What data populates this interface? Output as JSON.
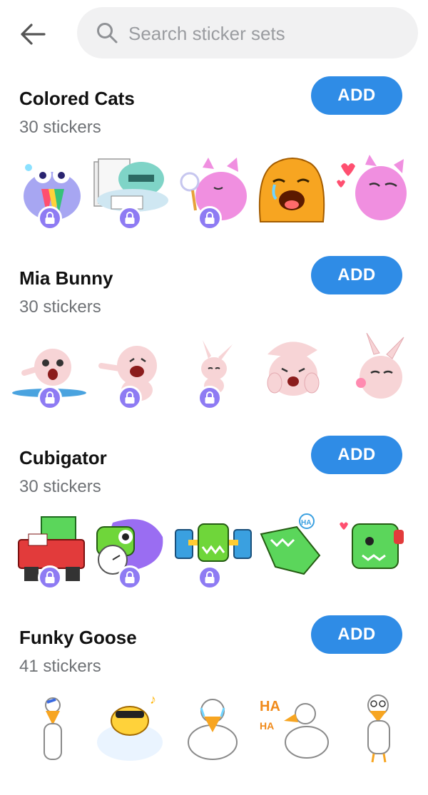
{
  "search": {
    "placeholder": "Search sticker sets"
  },
  "sets": [
    {
      "title": "Colored Cats",
      "count": "30 stickers",
      "add_label": "ADD",
      "stickers": [
        "purple-cat-rainbow",
        "teal-cat-papers",
        "pink-cat-bubbles",
        "orange-cat-crying",
        "pink-cat-hearts"
      ]
    },
    {
      "title": "Mia Bunny",
      "count": "30 stickers",
      "add_label": "ADD",
      "stickers": [
        "bunny-crying-pool",
        "bunny-laughing-pointing",
        "bunny-small-shy",
        "bunny-laughing-face",
        "bunny-blowing-kiss"
      ]
    },
    {
      "title": "Cubigator",
      "count": "30 stickers",
      "add_label": "ADD",
      "stickers": [
        "cubigator-red-car",
        "cubigator-stopwatch",
        "cubigator-dumbbells",
        "cubigator-laughing-ha",
        "cubigator-heart"
      ]
    },
    {
      "title": "Funky Goose",
      "count": "41 stickers",
      "add_label": "ADD",
      "stickers": [
        "goose-standing",
        "goose-sunglasses-music",
        "goose-crying",
        "goose-laughing-ha",
        "goose-glasses"
      ]
    }
  ],
  "stickers_text": {
    "ha": "HA",
    "ha_small": "HA"
  },
  "colors": {
    "accent": "#2f8ce6",
    "lock": "#8e7bf3",
    "search_bg": "#f1f1f2"
  }
}
